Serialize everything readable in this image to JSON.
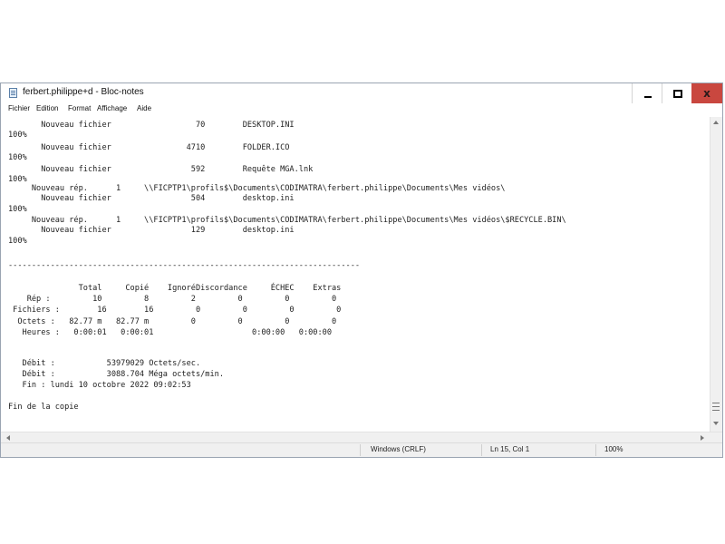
{
  "window": {
    "title": "ferbert.philippe+d - Bloc-notes",
    "controls": {
      "minimize": "",
      "maximize": "",
      "close": "x"
    }
  },
  "menu": [
    "Fichier",
    "Edition",
    "Format",
    "Affichage",
    "Aide"
  ],
  "content_lines": [
    "       Nouveau fichier                  70        DESKTOP.INI",
    "100%",
    "       Nouveau fichier                4710        FOLDER.ICO",
    "100%",
    "       Nouveau fichier                 592        Requête MGA.lnk",
    "100%",
    "     Nouveau rép.      1     \\\\FICPTP1\\profils$\\Documents\\CODIMATRA\\ferbert.philippe\\Documents\\Mes vidéos\\",
    "       Nouveau fichier                 504        desktop.ini",
    "100%",
    "     Nouveau rép.      1     \\\\FICPTP1\\profils$\\Documents\\CODIMATRA\\ferbert.philippe\\Documents\\Mes vidéos\\$RECYCLE.BIN\\",
    "       Nouveau fichier                 129        desktop.ini",
    "100%",
    "",
    "",
    "---------------------------------------------------------------------------",
    "",
    "",
    "               Total     Copié    IgnoréDiscordance     ÉCHEC    Extras",
    "    Rép :         10         8         2         0         0         0",
    " Fichiers :        16        16         0         0         0         0",
    "  Octets :   82.77 m   82.77 m         0         0         0         0",
    "   Heures :   0:00:01   0:00:01                     0:00:00   0:00:00",
    "",
    "",
    "",
    "   Débit :           53979029 Octets/sec.",
    "   Débit :           3088.704 Méga octets/min.",
    "   Fin : lundi 10 octobre 2022 09:02:53",
    "",
    "",
    "Fin de la copie"
  ],
  "status": {
    "encoding": "Windows (CRLF)",
    "position": "Ln 15, Col 1",
    "zoom": "100%"
  }
}
